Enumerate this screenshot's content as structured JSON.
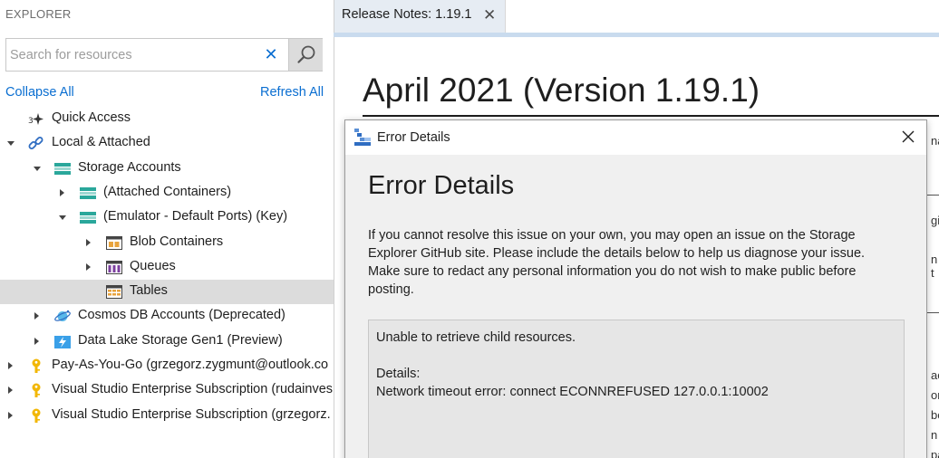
{
  "explorer": {
    "title": "EXPLORER",
    "search": {
      "placeholder": "Search for resources",
      "value": ""
    },
    "collapse_all": "Collapse All",
    "refresh_all": "Refresh All",
    "tree": [
      {
        "label": "Quick Access",
        "icon": "quick-access-icon",
        "level": 1,
        "expander": "none"
      },
      {
        "label": "Local & Attached",
        "icon": "link-icon",
        "level": 1,
        "expander": "expanded"
      },
      {
        "label": "Storage Accounts",
        "icon": "storage-accounts-icon",
        "level": 2,
        "expander": "expanded"
      },
      {
        "label": "(Attached Containers)",
        "icon": "storage-accounts-icon",
        "level": 3,
        "expander": "collapsed"
      },
      {
        "label": "(Emulator - Default Ports) (Key)",
        "icon": "storage-accounts-icon",
        "level": 3,
        "expander": "expanded"
      },
      {
        "label": "Blob Containers",
        "icon": "blob-container-icon",
        "level": 4,
        "expander": "collapsed"
      },
      {
        "label": "Queues",
        "icon": "queue-icon",
        "level": 4,
        "expander": "collapsed"
      },
      {
        "label": "Tables",
        "icon": "table-icon",
        "level": 4,
        "expander": "none",
        "selected": true
      },
      {
        "label": "Cosmos DB Accounts (Deprecated)",
        "icon": "cosmos-db-icon",
        "level": 2,
        "expander": "collapsed"
      },
      {
        "label": "Data Lake Storage Gen1 (Preview)",
        "icon": "data-lake-icon",
        "level": 2,
        "expander": "collapsed"
      },
      {
        "label": "Pay-As-You-Go (grzegorz.zygmunt@outlook.co",
        "icon": "key-icon",
        "level": 1,
        "expander": "collapsed"
      },
      {
        "label": "Visual Studio Enterprise Subscription (rudainves",
        "icon": "key-icon",
        "level": 1,
        "expander": "collapsed"
      },
      {
        "label": "Visual Studio Enterprise Subscription (grzegorz.",
        "icon": "key-icon",
        "level": 1,
        "expander": "collapsed"
      }
    ]
  },
  "tabs": [
    {
      "label": "Release Notes: 1.19.1",
      "active": true
    }
  ],
  "release_notes": {
    "heading": "April 2021 (Version 1.19.1)",
    "peek_fragments": [
      "na",
      "gi",
      "n t",
      "ac",
      "or",
      "be",
      "n",
      "pa"
    ]
  },
  "dialog": {
    "window_title": "Error Details",
    "heading": "Error Details",
    "message": "If you cannot resolve this issue on your own, you may open an issue on the Storage Explorer GitHub site. Please include the details below to help us diagnose your issue. Make sure to redact any personal information you do not wish to make public before posting.",
    "error_details": "Unable to retrieve child resources.\n\nDetails:\nNetwork timeout error: connect ECONNREFUSED 127.0.0.1:10002"
  },
  "colors": {
    "accent": "#0a6ed1",
    "selected_row": "#dcdcdc",
    "tab_active": "#e6ecf3",
    "dialog_bg": "#f0f0f0",
    "error_box_bg": "#e6e6e6"
  }
}
